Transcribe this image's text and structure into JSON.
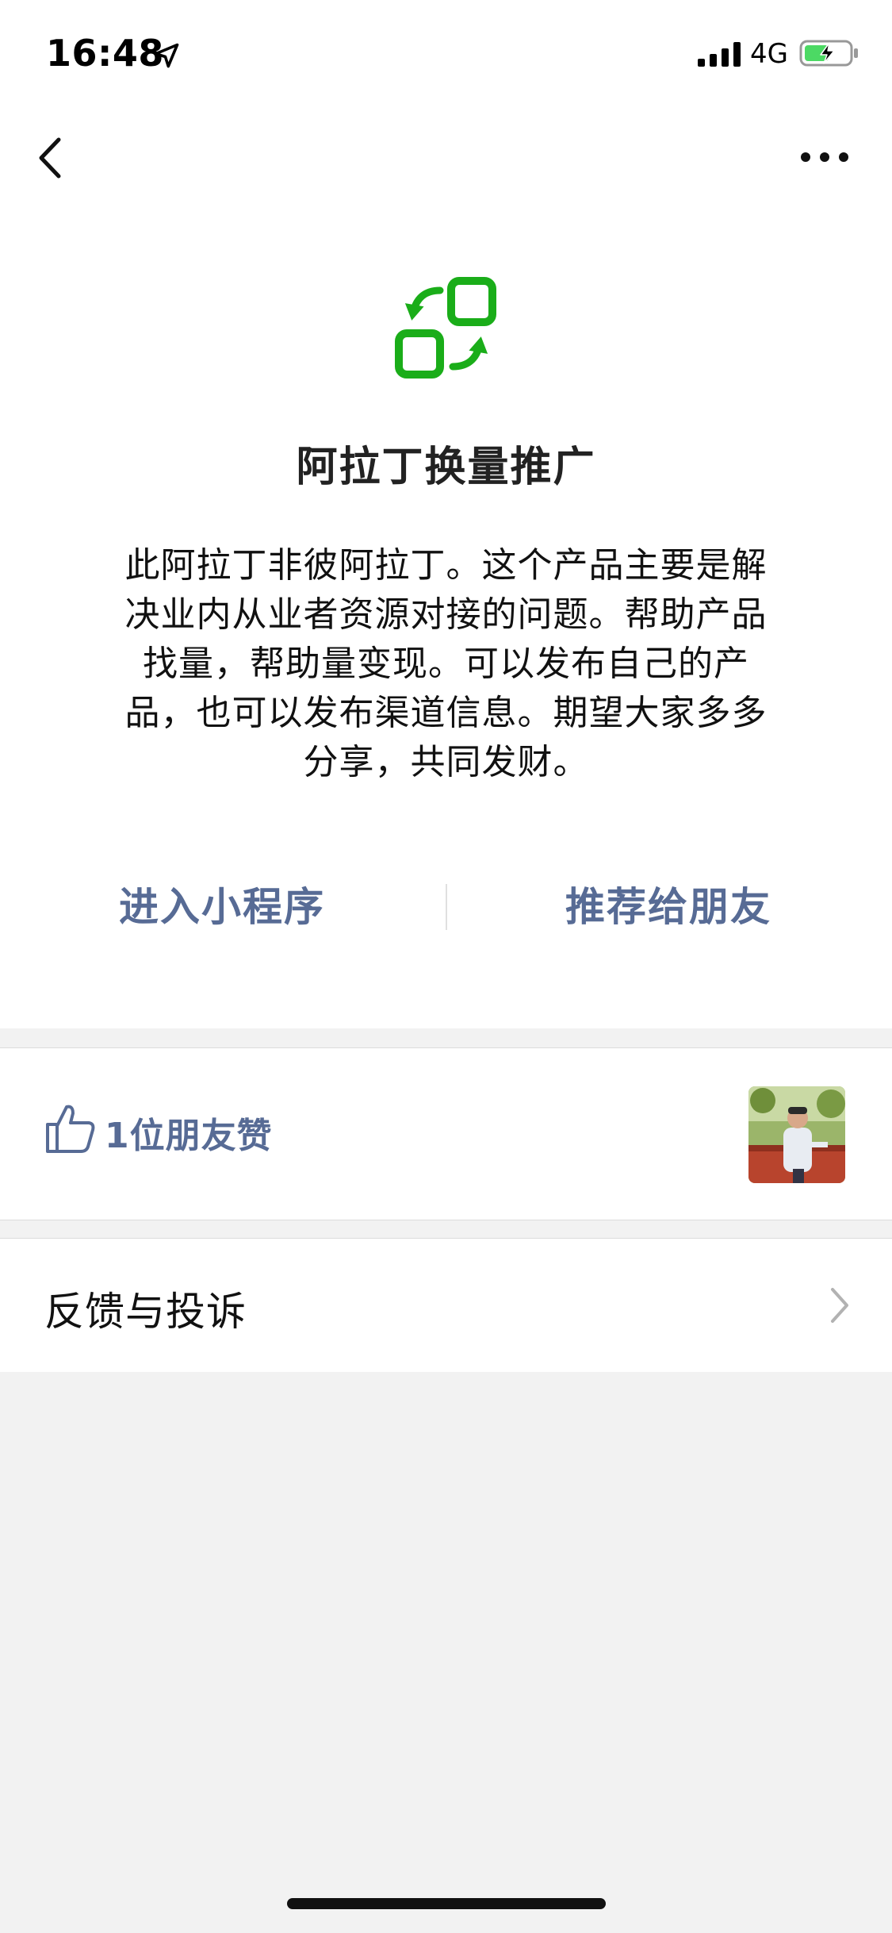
{
  "status_bar": {
    "time": "16:48",
    "network": "4G",
    "location_icon": "location-arrow-icon",
    "signal_icon": "signal-bars-icon",
    "battery_icon": "battery-charging-icon",
    "battery_color": "#4cd964"
  },
  "nav": {
    "back_icon": "chevron-left-icon",
    "more_icon": "more-dots-icon"
  },
  "app": {
    "logo_icon": "swap-squares-icon",
    "logo_color": "#1aad19",
    "title": "阿拉丁换量推广",
    "description": "此阿拉丁非彼阿拉丁。这个产品主要是解决业内从业者资源对接的问题。帮助产品找量，帮助量变现。可以发布自己的产品，也可以发布渠道信息。期望大家多多分享，共同发财。"
  },
  "actions": {
    "enter_label": "进入小程序",
    "share_label": "推荐给朋友",
    "link_color": "#576b95"
  },
  "likes": {
    "icon": "thumbs-up-icon",
    "text": "1位朋友赞"
  },
  "feedback": {
    "label": "反馈与投诉",
    "chevron_icon": "chevron-right-icon"
  }
}
